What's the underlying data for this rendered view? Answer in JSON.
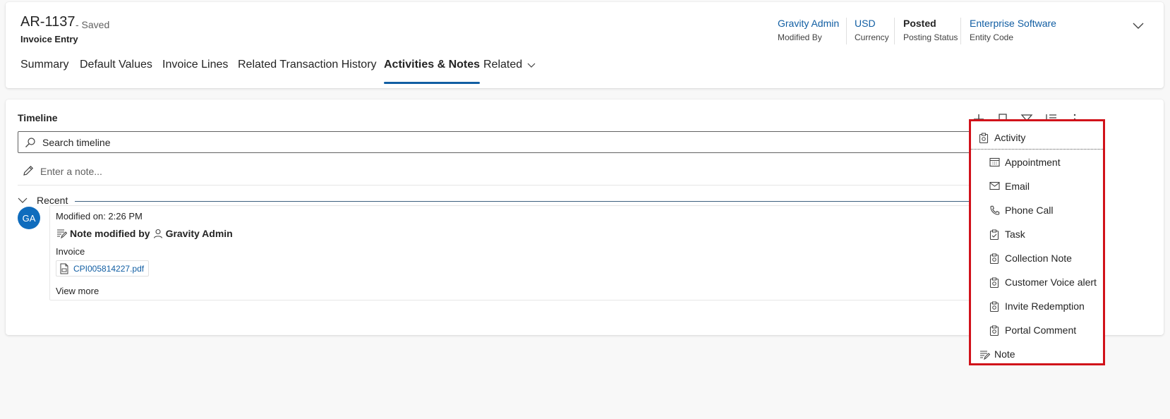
{
  "record": {
    "id": "AR-1137",
    "status": "- Saved",
    "entity": "Invoice Entry"
  },
  "header_fields": [
    {
      "value": "Gravity Admin",
      "label": "Modified By"
    },
    {
      "value": "USD",
      "label": "Currency"
    },
    {
      "value": "Posted",
      "label": "Posting Status"
    },
    {
      "value": "Enterprise Software",
      "label": "Entity Code"
    }
  ],
  "tabs": [
    {
      "label": "Summary"
    },
    {
      "label": "Default Values"
    },
    {
      "label": "Invoice Lines"
    },
    {
      "label": "Related Transaction History"
    },
    {
      "label": "Activities & Notes",
      "active": true
    },
    {
      "label": "Related"
    }
  ],
  "timeline": {
    "title": "Timeline",
    "search_placeholder": "Search timeline",
    "note_placeholder": "Enter a note...",
    "group_label": "Recent",
    "post": {
      "avatar_initials": "GA",
      "modified_text": "Modified on: 2:26 PM",
      "title_prefix": "Note modified by",
      "author": "Gravity Admin",
      "subject": "Invoice",
      "attachment": "CPI005814227.pdf",
      "view_more": "View more"
    }
  },
  "add_menu": {
    "items": [
      {
        "label": "Activity",
        "icon": "activity-icon"
      },
      {
        "label": "Appointment",
        "icon": "calendar-icon"
      },
      {
        "label": "Email",
        "icon": "mail-icon"
      },
      {
        "label": "Phone Call",
        "icon": "phone-icon"
      },
      {
        "label": "Task",
        "icon": "task-icon"
      },
      {
        "label": "Collection Note",
        "icon": "activity-icon"
      },
      {
        "label": "Customer Voice alert",
        "icon": "activity-icon"
      },
      {
        "label": "Invite Redemption",
        "icon": "activity-icon"
      },
      {
        "label": "Portal Comment",
        "icon": "activity-icon"
      },
      {
        "label": "Note",
        "icon": "note-icon"
      }
    ]
  },
  "colors": {
    "accent": "#115ea3",
    "avatar": "#0f6cbd",
    "highlight_border": "#d1121a"
  }
}
